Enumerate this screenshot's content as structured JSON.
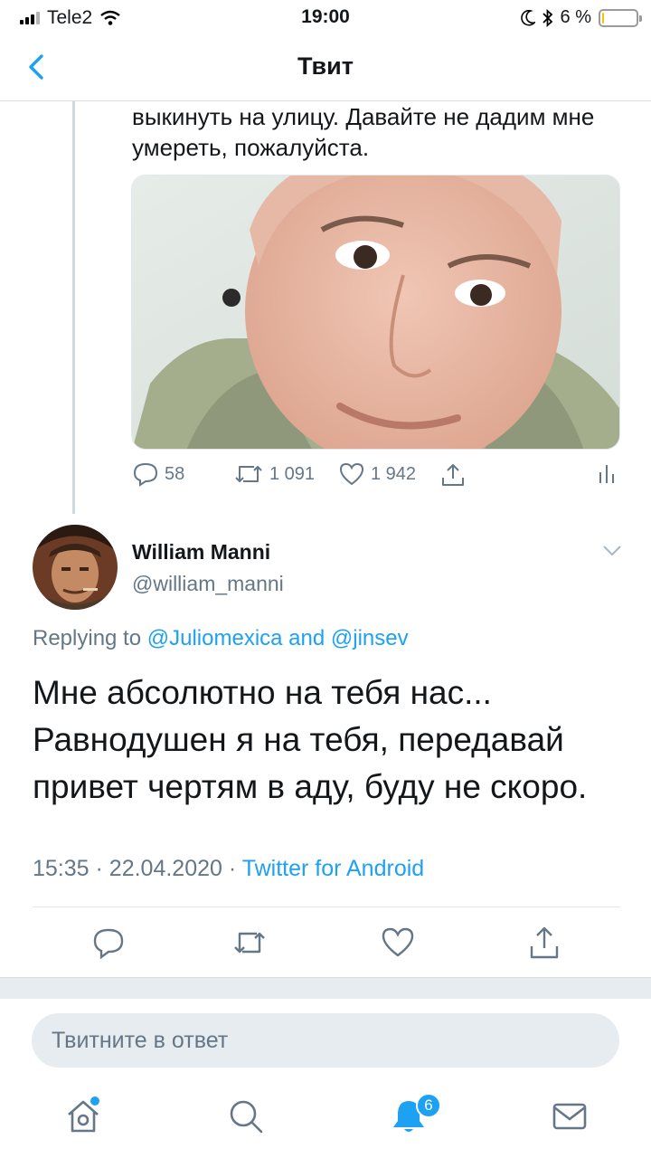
{
  "status_bar": {
    "carrier": "Tele2",
    "time": "19:00",
    "battery_percent": "6 %",
    "battery_level": 0.06
  },
  "nav": {
    "title": "Твит",
    "back_icon": "chevron-left-icon"
  },
  "previous_tweet": {
    "text": "выкинуть на улицу. Давайте не дадим мне умереть, пожалуйста.",
    "replies": "58",
    "retweets": "1 091",
    "likes": "1 942"
  },
  "tweet": {
    "author_name": "William Manni",
    "author_handle": "@william_manni",
    "replying_prefix": "Replying to",
    "mention_1": "@Juliomexica",
    "replying_and": "and",
    "mention_2": "@jinsev",
    "text": "Мне абсолютно на тебя нас... Равнодушен я на тебя, передавай привет чертям в аду, буду не скоро.",
    "time": "15:35",
    "date": "22.04.2020",
    "source": "Twitter for Android"
  },
  "reply_input": {
    "placeholder": "Твитните в ответ"
  },
  "tabs": {
    "notifications_badge": "6"
  },
  "colors": {
    "accent": "#1da1f2",
    "muted": "#657786",
    "text": "#14171a"
  }
}
